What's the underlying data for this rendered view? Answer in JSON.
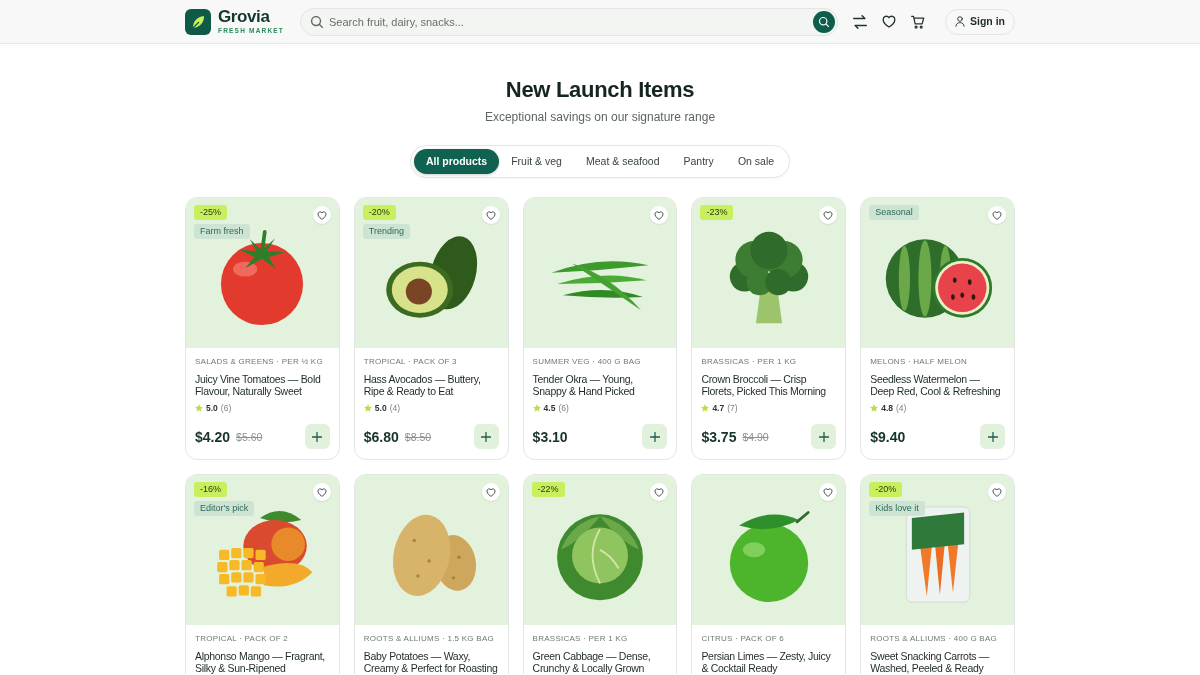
{
  "header": {
    "brand": {
      "name": "Grovia",
      "tagline": "FRESH MARKET"
    },
    "search": {
      "placeholder": "Search fruit, dairy, snacks..."
    },
    "sign_in": "Sign in"
  },
  "section": {
    "title": "New Launch Items",
    "subtitle": "Exceptional savings on our signature range"
  },
  "filters": [
    {
      "label": "All products",
      "selected": true
    },
    {
      "label": "Fruit & veg",
      "selected": false
    },
    {
      "label": "Meat & seafood",
      "selected": false
    },
    {
      "label": "Pantry",
      "selected": false
    },
    {
      "label": "On sale",
      "selected": false
    }
  ],
  "products": [
    {
      "kind": "tomato",
      "badges": [
        {
          "kind": "discount",
          "text": "-25%"
        },
        {
          "kind": "tag",
          "text": "Farm fresh"
        }
      ],
      "category": "SALADS & GREENS · PER ½ KG",
      "title": "Juicy Vine Tomatoes — Bold Flavour, Naturally Sweet",
      "rating": "5.0",
      "reviews": "(6)",
      "price": "$4.20",
      "old_price": "$5.60"
    },
    {
      "kind": "avocado",
      "badges": [
        {
          "kind": "discount",
          "text": "-20%"
        },
        {
          "kind": "tag",
          "text": "Trending"
        }
      ],
      "category": "TROPICAL · PACK OF 3",
      "title": "Hass Avocados — Buttery, Ripe & Ready to Eat",
      "rating": "5.0",
      "reviews": "(4)",
      "price": "$6.80",
      "old_price": "$8.50"
    },
    {
      "kind": "okra",
      "category": "SUMMER VEG · 400 G BAG",
      "title": "Tender Okra — Young, Snappy & Hand Picked",
      "rating": "4.5",
      "reviews": "(6)",
      "price": "$3.10"
    },
    {
      "kind": "broccoli",
      "badges": [
        {
          "kind": "discount",
          "text": "-23%"
        }
      ],
      "category": "BRASSICAS · PER 1 KG",
      "title": "Crown Broccoli — Crisp Florets, Picked This Morning",
      "rating": "4.7",
      "reviews": "(7)",
      "price": "$3.75",
      "old_price": "$4.90"
    },
    {
      "kind": "watermelon",
      "badges": [
        {
          "kind": "tag",
          "text": "Seasonal"
        }
      ],
      "category": "MELONS · HALF MELON",
      "title": "Seedless Watermelon — Deep Red, Cool & Refreshing",
      "rating": "4.8",
      "reviews": "(4)",
      "price": "$9.40"
    },
    {
      "kind": "mango",
      "badges": [
        {
          "kind": "discount",
          "text": "-16%"
        },
        {
          "kind": "tag",
          "text": "Editor's pick"
        }
      ],
      "category": "TROPICAL · PACK OF 2",
      "title": "Alphonso Mango — Fragrant, Silky & Sun-Ripened"
    },
    {
      "kind": "potato",
      "category": "ROOTS & ALLIUMS · 1.5 KG BAG",
      "title": "Baby Potatoes — Waxy, Creamy & Perfect for Roasting"
    },
    {
      "kind": "cabbage",
      "badges": [
        {
          "kind": "discount",
          "text": "-22%"
        }
      ],
      "category": "BRASSICAS · PER 1 KG",
      "title": "Green Cabbage — Dense, Crunchy & Locally Grown"
    },
    {
      "kind": "lime",
      "category": "CITRUS · PACK OF 6",
      "title": "Persian Limes — Zesty, Juicy & Cocktail Ready"
    },
    {
      "kind": "carrots",
      "badges": [
        {
          "kind": "discount",
          "text": "-20%"
        },
        {
          "kind": "tag",
          "text": "Kids love it"
        }
      ],
      "category": "ROOTS & ALLIUMS · 400 G BAG",
      "title": "Sweet Snacking Carrots — Washed, Peeled & Ready"
    }
  ]
}
